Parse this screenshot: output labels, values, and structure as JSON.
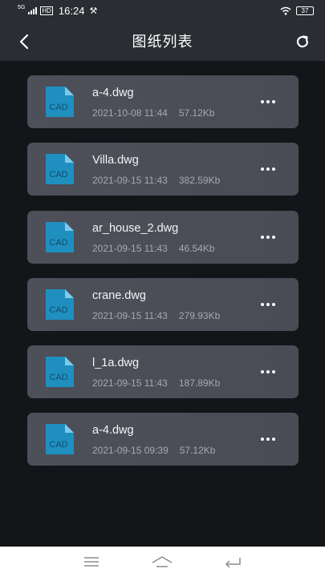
{
  "status": {
    "network": "5G",
    "hd": "HD",
    "time": "16:24",
    "battery": "37"
  },
  "header": {
    "title": "图纸列表"
  },
  "files": [
    {
      "name": "a-4.dwg",
      "date": "2021-10-08 11:44",
      "size": "57.12Kb",
      "icon_text": "CAD"
    },
    {
      "name": "Villa.dwg",
      "date": "2021-09-15 11:43",
      "size": "382.59Kb",
      "icon_text": "CAD"
    },
    {
      "name": "ar_house_2.dwg",
      "date": "2021-09-15 11:43",
      "size": "46.54Kb",
      "icon_text": "CAD"
    },
    {
      "name": "crane.dwg",
      "date": "2021-09-15 11:43",
      "size": "279.93Kb",
      "icon_text": "CAD"
    },
    {
      "name": "l_1a.dwg",
      "date": "2021-09-15 11:43",
      "size": "187.89Kb",
      "icon_text": "CAD"
    },
    {
      "name": "a-4.dwg",
      "date": "2021-09-15 09:39",
      "size": "57.12Kb",
      "icon_text": "CAD"
    }
  ],
  "colors": {
    "background": "#141519",
    "header": "#2b2d33",
    "card": "#4d4f59",
    "cad_icon": "#1f8fc0",
    "meta_text": "#a7a9b1"
  },
  "icons": {
    "back": "chevron-left-icon",
    "refresh": "refresh-icon",
    "more": "more-horizontal-icon",
    "file": "cad-file-icon",
    "nav_menu": "menu-icon",
    "nav_home": "home-icon",
    "nav_back": "back-icon"
  }
}
